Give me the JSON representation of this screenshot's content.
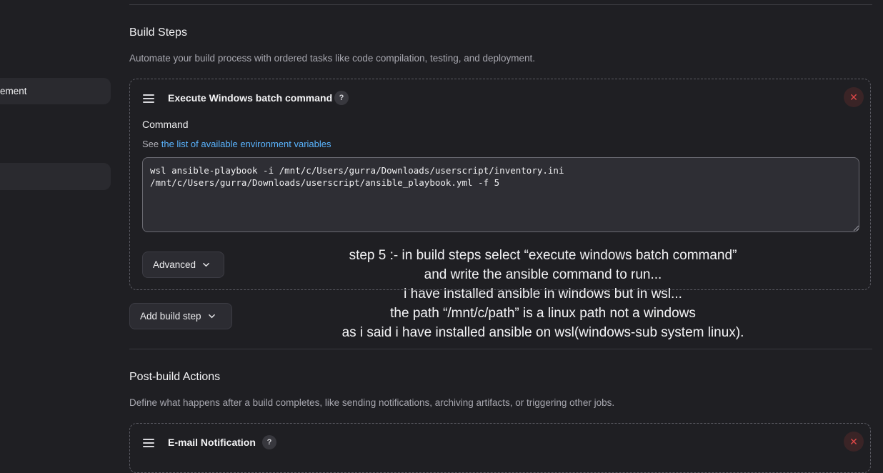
{
  "sidebar": {
    "items": [
      {
        "label": "ement"
      },
      {
        "label": ""
      }
    ]
  },
  "build_steps": {
    "title": "Build Steps",
    "description": "Automate your build process with ordered tasks like code compilation, testing, and deployment.",
    "step": {
      "title": "Execute Windows batch command",
      "help": "?",
      "close": "✕",
      "command_label": "Command",
      "hint_prefix": "See ",
      "hint_link": "the list of available environment variables",
      "command_text": "wsl ansible-playbook -i /mnt/c/Users/gurra/Downloads/userscript/inventory.ini\n/mnt/c/Users/gurra/Downloads/userscript/ansible_playbook.yml -f 5",
      "advanced_label": "Advanced"
    },
    "add_step_label": "Add build step"
  },
  "annotation": {
    "lines": [
      "step 5 :- in build steps select “execute windows batch command”",
      "and write the ansible command to run...",
      "i have installed ansible in windows but in wsl...",
      "the path “/mnt/c/path” is a linux path not a windows",
      "as i said i have installed ansible on wsl(windows-sub system linux)."
    ]
  },
  "post_build": {
    "title": "Post-build Actions",
    "description": "Define what happens after a build completes, like sending notifications, archiving artifacts, or triggering other jobs.",
    "step": {
      "title": "E-mail Notification",
      "help": "?",
      "close": "✕"
    }
  },
  "colors": {
    "background": "#1f1f23",
    "link": "#5ab4ff",
    "danger": "#e04848"
  }
}
